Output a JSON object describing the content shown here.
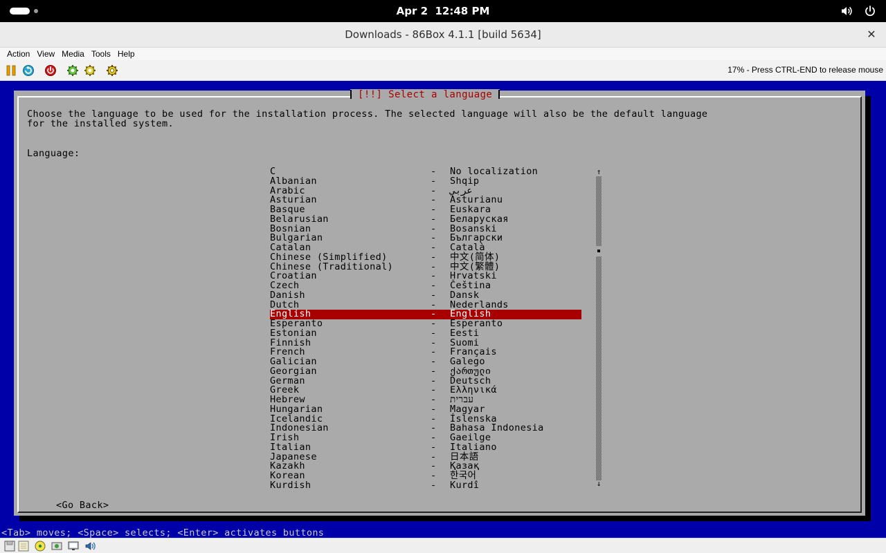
{
  "topbar": {
    "date": "Apr 2",
    "time": "12:48 PM",
    "icons": [
      "activities-indicator",
      "speaker-icon",
      "power-icon"
    ]
  },
  "window": {
    "title": "Downloads - 86Box 4.1.1 [build 5634]",
    "close_glyph": "✕"
  },
  "menubar": {
    "items": [
      "Action",
      "View",
      "Media",
      "Tools",
      "Help"
    ]
  },
  "toolbar": {
    "buttons": [
      "pause-icon",
      "reset-icon",
      "power-off-icon",
      "ctrl-alt-del-icon",
      "ctrl-alt-esc-icon",
      "settings-icon"
    ],
    "status": "17% - Press CTRL-END to release mouse"
  },
  "installer": {
    "title": "[!!] Select a language",
    "prompt_line1": "Choose the language to be used for the installation process. The selected language will also be the default language",
    "prompt_line2": "for the installed system.",
    "language_label": "Language:",
    "separator": "-",
    "selected_index": 15,
    "languages": [
      {
        "name": "C",
        "native": "No localization"
      },
      {
        "name": "Albanian",
        "native": "Shqip"
      },
      {
        "name": "Arabic",
        "native": "عربي"
      },
      {
        "name": "Asturian",
        "native": "Asturianu"
      },
      {
        "name": "Basque",
        "native": "Euskara"
      },
      {
        "name": "Belarusian",
        "native": "Беларуская"
      },
      {
        "name": "Bosnian",
        "native": "Bosanski"
      },
      {
        "name": "Bulgarian",
        "native": "Български"
      },
      {
        "name": "Catalan",
        "native": "Català"
      },
      {
        "name": "Chinese (Simplified)",
        "native": "中文(简体)"
      },
      {
        "name": "Chinese (Traditional)",
        "native": "中文(繁體)"
      },
      {
        "name": "Croatian",
        "native": "Hrvatski"
      },
      {
        "name": "Czech",
        "native": "Čeština"
      },
      {
        "name": "Danish",
        "native": "Dansk"
      },
      {
        "name": "Dutch",
        "native": "Nederlands"
      },
      {
        "name": "English",
        "native": "English"
      },
      {
        "name": "Esperanto",
        "native": "Esperanto"
      },
      {
        "name": "Estonian",
        "native": "Eesti"
      },
      {
        "name": "Finnish",
        "native": "Suomi"
      },
      {
        "name": "French",
        "native": "Français"
      },
      {
        "name": "Galician",
        "native": "Galego"
      },
      {
        "name": "Georgian",
        "native": "ქართული"
      },
      {
        "name": "German",
        "native": "Deutsch"
      },
      {
        "name": "Greek",
        "native": "Ελληνικά"
      },
      {
        "name": "Hebrew",
        "native": "עברית"
      },
      {
        "name": "Hungarian",
        "native": "Magyar"
      },
      {
        "name": "Icelandic",
        "native": "Íslenska"
      },
      {
        "name": "Indonesian",
        "native": "Bahasa Indonesia"
      },
      {
        "name": "Irish",
        "native": "Gaeilge"
      },
      {
        "name": "Italian",
        "native": "Italiano"
      },
      {
        "name": "Japanese",
        "native": "日本語"
      },
      {
        "name": "Kazakh",
        "native": "Қазақ"
      },
      {
        "name": "Korean",
        "native": "한국어"
      },
      {
        "name": "Kurdish",
        "native": "Kurdî"
      }
    ],
    "scroll_up_glyph": "↑",
    "scroll_down_glyph": "↓",
    "go_back": "<Go Back>",
    "help": "<Tab> moves; <Space> selects; <Enter> activates buttons"
  },
  "statusbar": {
    "icons": [
      "floppy-drive-1-icon",
      "floppy-drive-2-icon",
      "cdrom-icon",
      "hard-disk-icon",
      "network-icon",
      "sound-icon"
    ]
  },
  "colors": {
    "screen_bg": "#0000a8",
    "dialog_bg": "#aaaaaa",
    "title_red": "#a80000",
    "selection_bg": "#a80000"
  }
}
